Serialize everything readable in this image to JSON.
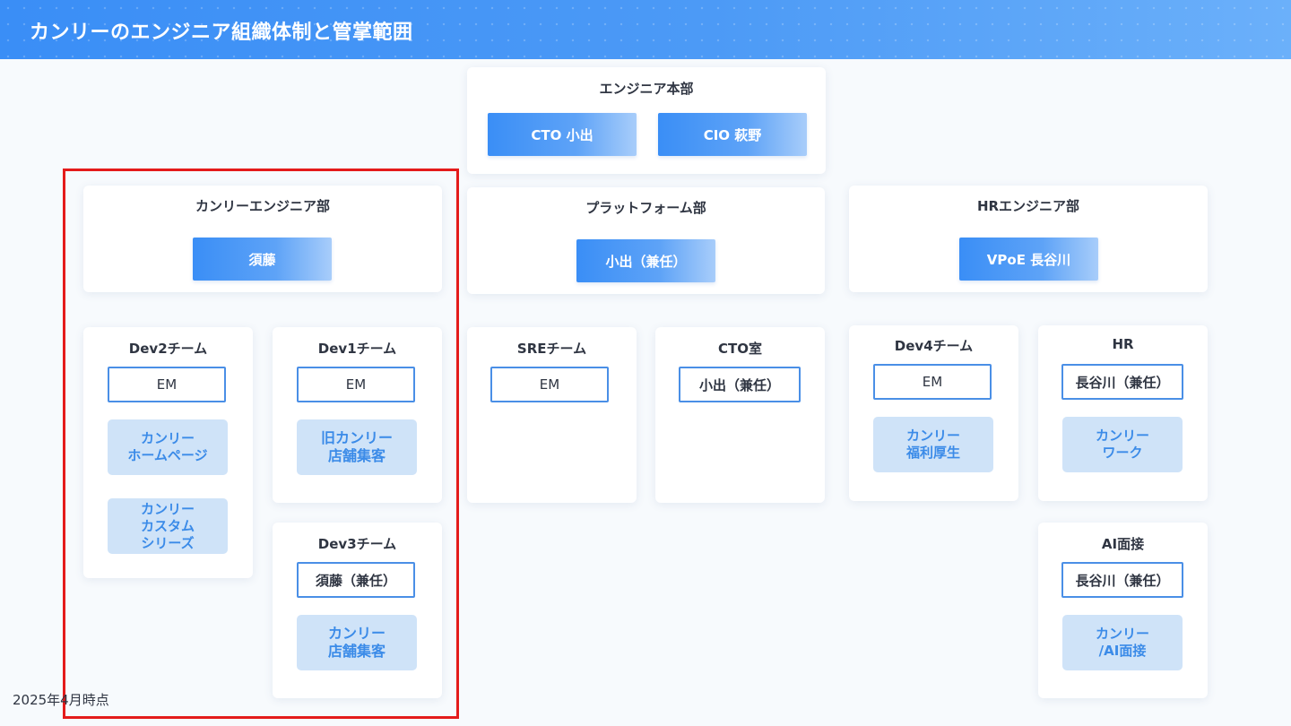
{
  "page": {
    "title": "カンリーのエンジニア組織体制と管掌範囲"
  },
  "hq": {
    "title": "エンジニア本部",
    "cto": "CTO 小出",
    "cio": "CIO 萩野"
  },
  "departments": {
    "kanry": {
      "title": "カンリーエンジニア部",
      "lead": "須藤"
    },
    "platform": {
      "title": "プラットフォーム部",
      "lead": "小出（兼任）"
    },
    "hr_eng": {
      "title": "HRエンジニア部",
      "lead": "VPoE 長谷川"
    }
  },
  "teams": {
    "dev2": {
      "title": "Dev2チーム",
      "manager": "EM",
      "services": [
        "カンリー\nホームページ",
        "カンリー\nカスタム\nシリーズ"
      ]
    },
    "dev1": {
      "title": "Dev1チーム",
      "manager": "EM",
      "services": [
        "旧カンリー\n店舗集客"
      ]
    },
    "dev3": {
      "title": "Dev3チーム",
      "manager": "須藤（兼任）",
      "services": [
        "カンリー\n店舗集客"
      ]
    },
    "sre": {
      "title": "SREチーム",
      "manager": "EM"
    },
    "cto_office": {
      "title": "CTO室",
      "manager": "小出（兼任）"
    },
    "dev4": {
      "title": "Dev4チーム",
      "manager": "EM",
      "services": [
        "カンリー\n福利厚生"
      ]
    },
    "hr": {
      "title": "HR",
      "manager": "長谷川（兼任）",
      "services": [
        "カンリー\nワーク"
      ]
    },
    "ai": {
      "title": "AI面接",
      "manager": "長谷川（兼任）",
      "services": [
        "カンリー\n/AI面接"
      ]
    }
  },
  "highlight": {
    "color": "#e41b1b"
  },
  "colors": {
    "accent": "#3a8ef6",
    "service_bg": "#cfe3f8",
    "service_text": "#3b8be8"
  },
  "footer": {
    "as_of": "2025年4月時点"
  }
}
